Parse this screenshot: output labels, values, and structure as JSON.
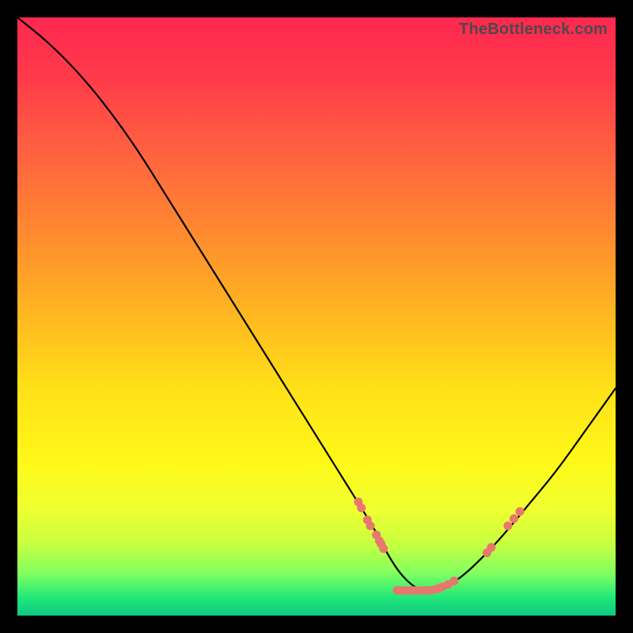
{
  "watermark": "TheBottleneck.com",
  "chart_data": {
    "type": "line",
    "title": "",
    "xlabel": "",
    "ylabel": "",
    "xlim": [
      0,
      100
    ],
    "ylim": [
      0,
      100
    ],
    "grid": false,
    "legend": false,
    "series": [
      {
        "name": "curve",
        "x": [
          0,
          5,
          10,
          15,
          20,
          25,
          30,
          35,
          40,
          45,
          50,
          55,
          60,
          62,
          64,
          66,
          68,
          70,
          72,
          75,
          80,
          85,
          90,
          95,
          100
        ],
        "y": [
          100,
          96,
          91,
          85,
          78,
          70,
          62,
          54,
          46,
          38,
          30,
          22,
          14,
          10,
          7,
          5,
          4,
          4,
          5,
          7,
          12,
          18,
          24,
          31,
          38
        ]
      }
    ],
    "markers": {
      "name": "highlighted-points",
      "color": "#e8776d",
      "points": [
        {
          "x": 57.0,
          "y": 19.0
        },
        {
          "x": 57.5,
          "y": 18.0
        },
        {
          "x": 58.5,
          "y": 16.0
        },
        {
          "x": 59.0,
          "y": 15.0
        },
        {
          "x": 60.0,
          "y": 13.5
        },
        {
          "x": 60.5,
          "y": 12.5
        },
        {
          "x": 60.8,
          "y": 12.0
        },
        {
          "x": 61.2,
          "y": 11.2
        },
        {
          "x": 63.5,
          "y": 4.2
        },
        {
          "x": 64.0,
          "y": 4.2
        },
        {
          "x": 64.8,
          "y": 4.2
        },
        {
          "x": 65.5,
          "y": 4.2
        },
        {
          "x": 66.2,
          "y": 4.2
        },
        {
          "x": 67.0,
          "y": 4.2
        },
        {
          "x": 68.0,
          "y": 4.2
        },
        {
          "x": 68.8,
          "y": 4.2
        },
        {
          "x": 69.5,
          "y": 4.3
        },
        {
          "x": 70.3,
          "y": 4.5
        },
        {
          "x": 71.0,
          "y": 4.8
        },
        {
          "x": 72.0,
          "y": 5.2
        },
        {
          "x": 73.0,
          "y": 5.8
        },
        {
          "x": 78.5,
          "y": 10.5
        },
        {
          "x": 79.2,
          "y": 11.4
        },
        {
          "x": 82.0,
          "y": 15.0
        },
        {
          "x": 83.0,
          "y": 16.2
        },
        {
          "x": 84.0,
          "y": 17.4
        }
      ]
    }
  }
}
